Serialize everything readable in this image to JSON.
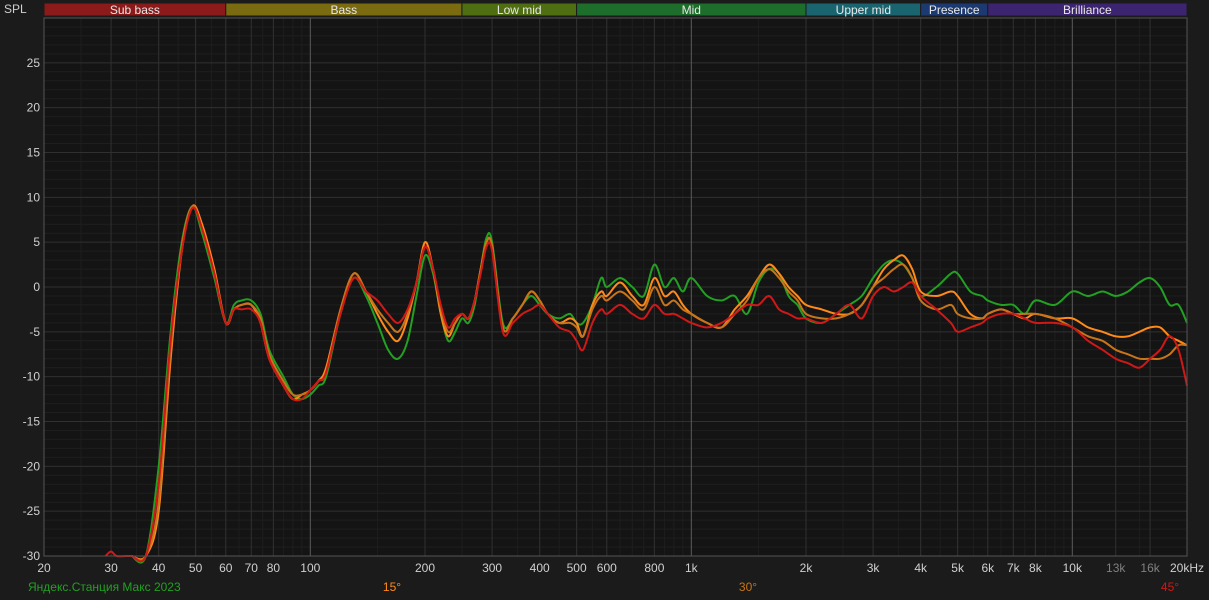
{
  "chart_data": {
    "type": "line",
    "ylabel": "SPL",
    "x_scale": "log",
    "xlim": [
      20,
      20000
    ],
    "ylim": [
      -30,
      30
    ],
    "grid": true,
    "bands": [
      {
        "name": "Sub bass",
        "from": 20,
        "to": 60,
        "color": "#8b1a1a"
      },
      {
        "name": "Bass",
        "from": 60,
        "to": 250,
        "color": "#7a6a10"
      },
      {
        "name": "Low mid",
        "from": 250,
        "to": 500,
        "color": "#4f6e12"
      },
      {
        "name": "Mid",
        "from": 500,
        "to": 2000,
        "color": "#1d6e2a"
      },
      {
        "name": "Upper mid",
        "from": 2000,
        "to": 4000,
        "color": "#1a6470"
      },
      {
        "name": "Presence",
        "from": 4000,
        "to": 6000,
        "color": "#1d3a70"
      },
      {
        "name": "Brilliance",
        "from": 6000,
        "to": 20000,
        "color": "#3d2470"
      }
    ],
    "y_ticks": [
      25,
      20,
      15,
      10,
      5,
      0,
      -5,
      -10,
      -15,
      -20,
      -25,
      -30
    ],
    "x_ticks": [
      {
        "v": 20,
        "label": "20"
      },
      {
        "v": 30,
        "label": "30"
      },
      {
        "v": 40,
        "label": "40"
      },
      {
        "v": 50,
        "label": "50"
      },
      {
        "v": 60,
        "label": "60"
      },
      {
        "v": 70,
        "label": "70"
      },
      {
        "v": 80,
        "label": "80"
      },
      {
        "v": 100,
        "label": "100"
      },
      {
        "v": 200,
        "label": "200"
      },
      {
        "v": 300,
        "label": "300"
      },
      {
        "v": 400,
        "label": "400"
      },
      {
        "v": 500,
        "label": "500"
      },
      {
        "v": 600,
        "label": "600"
      },
      {
        "v": 800,
        "label": "800"
      },
      {
        "v": 1000,
        "label": "1k"
      },
      {
        "v": 2000,
        "label": "2k"
      },
      {
        "v": 3000,
        "label": "3k"
      },
      {
        "v": 4000,
        "label": "4k"
      },
      {
        "v": 5000,
        "label": "5k"
      },
      {
        "v": 6000,
        "label": "6k"
      },
      {
        "v": 7000,
        "label": "7k"
      },
      {
        "v": 8000,
        "label": "8k"
      },
      {
        "v": 10000,
        "label": "10k"
      },
      {
        "v": 13000,
        "label": "13k"
      },
      {
        "v": 16000,
        "label": "16k"
      },
      {
        "v": 20000,
        "label": "20kHz"
      }
    ],
    "series": [
      {
        "name": "Яндекс.Станция Макс 2023",
        "color": "#22a022",
        "x": [
          34,
          37,
          40,
          43,
          46,
          49,
          52,
          56,
          60,
          63,
          66,
          70,
          74,
          78,
          85,
          90,
          95,
          100,
          105,
          110,
          120,
          130,
          140,
          150,
          160,
          170,
          180,
          190,
          200,
          210,
          220,
          230,
          240,
          250,
          260,
          270,
          280,
          290,
          300,
          320,
          340,
          360,
          380,
          400,
          420,
          450,
          480,
          500,
          520,
          550,
          580,
          600,
          650,
          700,
          750,
          800,
          850,
          900,
          950,
          1000,
          1100,
          1200,
          1300,
          1400,
          1500,
          1600,
          1700,
          1800,
          1900,
          2000,
          2200,
          2400,
          2600,
          2800,
          3000,
          3200,
          3400,
          3600,
          3800,
          4000,
          4400,
          4800,
          5000,
          5400,
          5800,
          6000,
          6500,
          7000,
          7500,
          8000,
          9000,
          10000,
          11000,
          12000,
          13000,
          14000,
          15000,
          16000,
          17000,
          18000,
          19000,
          20000
        ],
        "y": [
          -30,
          -30,
          -20,
          -5,
          5,
          9,
          6,
          1,
          -4,
          -2,
          -1.5,
          -1.5,
          -3,
          -7,
          -10,
          -12,
          -12.5,
          -12,
          -11,
          -10,
          -3,
          1,
          -1,
          -4,
          -7,
          -8,
          -6,
          -1,
          3.5,
          1.5,
          -3,
          -6,
          -5,
          -3.5,
          -4,
          -2,
          2,
          5.5,
          5,
          -4,
          -3.5,
          -2,
          -1,
          -2,
          -3,
          -3.5,
          -3,
          -4,
          -4,
          -2,
          1,
          0,
          1,
          0,
          -1,
          2.5,
          0,
          1,
          -0.5,
          1,
          -1,
          -1.5,
          -1,
          -3,
          0.5,
          2,
          1.5,
          -1,
          -2,
          -3.5,
          -4,
          -3,
          -2,
          -1,
          1,
          2.5,
          3,
          2.5,
          1,
          -1,
          0,
          1.5,
          1.5,
          -0.5,
          -1,
          -1.5,
          -2,
          -2,
          -3,
          -1.5,
          -2,
          -0.5,
          -1,
          -0.5,
          -1,
          -0.5,
          0.5,
          1,
          0,
          -2,
          -2,
          -4
        ]
      },
      {
        "name": "15°",
        "color": "#ff8a1a",
        "x": [
          34,
          37,
          40,
          43,
          46,
          49,
          52,
          56,
          60,
          63,
          66,
          70,
          74,
          78,
          85,
          90,
          95,
          100,
          105,
          110,
          120,
          130,
          140,
          150,
          160,
          170,
          180,
          190,
          200,
          210,
          220,
          230,
          240,
          250,
          260,
          270,
          280,
          290,
          300,
          320,
          340,
          360,
          380,
          400,
          420,
          450,
          480,
          500,
          520,
          550,
          580,
          600,
          650,
          700,
          750,
          800,
          850,
          900,
          950,
          1000,
          1100,
          1200,
          1300,
          1400,
          1500,
          1600,
          1700,
          1800,
          1900,
          2000,
          2200,
          2400,
          2600,
          2800,
          3000,
          3200,
          3400,
          3600,
          3800,
          4000,
          4400,
          4800,
          5000,
          5400,
          5800,
          6000,
          6500,
          7000,
          7500,
          8000,
          9000,
          10000,
          11000,
          12000,
          13000,
          14000,
          15000,
          16000,
          17000,
          18000,
          19000,
          20000
        ],
        "y": [
          -30,
          -30,
          -25,
          -8,
          4,
          9,
          7,
          2,
          -4,
          -2.5,
          -2,
          -2,
          -4,
          -8,
          -11,
          -12.5,
          -12,
          -11.5,
          -10.5,
          -9,
          -2.5,
          1.5,
          -0.5,
          -3,
          -5,
          -6,
          -3.5,
          0.5,
          5,
          2,
          -3,
          -5.5,
          -4,
          -3,
          -3.5,
          -1.5,
          2,
          5,
          4.5,
          -4.5,
          -3.5,
          -2,
          -0.5,
          -1.5,
          -3,
          -4,
          -3.5,
          -4,
          -5.5,
          -2,
          -0.5,
          -1,
          0.5,
          -1,
          -2,
          1,
          -1,
          -0.5,
          -2,
          -3,
          -4,
          -4.5,
          -2.5,
          -1,
          1,
          2.5,
          1.5,
          0,
          -1,
          -2,
          -2.5,
          -3,
          -3,
          -2,
          0,
          2,
          3,
          3.5,
          2,
          -0.5,
          -1,
          -0.5,
          -1,
          -3,
          -3.5,
          -3,
          -2.5,
          -3,
          -3.5,
          -3,
          -3.5,
          -3.5,
          -4.5,
          -5,
          -5.5,
          -5.5,
          -5,
          -4.5,
          -4.5,
          -5.5,
          -6,
          -6.5
        ]
      },
      {
        "name": "30°",
        "color": "#c8741a",
        "x": [
          34,
          37,
          40,
          43,
          46,
          49,
          52,
          56,
          60,
          63,
          66,
          70,
          74,
          78,
          85,
          90,
          95,
          100,
          105,
          110,
          120,
          130,
          140,
          150,
          160,
          170,
          180,
          190,
          200,
          210,
          220,
          230,
          240,
          250,
          260,
          270,
          280,
          290,
          300,
          320,
          340,
          360,
          380,
          400,
          420,
          450,
          480,
          500,
          520,
          550,
          580,
          600,
          650,
          700,
          750,
          800,
          850,
          900,
          950,
          1000,
          1100,
          1200,
          1300,
          1400,
          1500,
          1600,
          1700,
          1800,
          1900,
          2000,
          2200,
          2400,
          2600,
          2800,
          3000,
          3200,
          3400,
          3600,
          3800,
          4000,
          4400,
          4800,
          5000,
          5400,
          5800,
          6000,
          6500,
          7000,
          7500,
          8000,
          9000,
          10000,
          11000,
          12000,
          13000,
          14000,
          15000,
          16000,
          17000,
          18000,
          19000,
          20000
        ],
        "y": [
          -30,
          -30,
          -24,
          -7,
          4.5,
          9,
          6.5,
          1.5,
          -4,
          -2.5,
          -2,
          -2,
          -3.5,
          -7.5,
          -10.5,
          -12,
          -12,
          -11.5,
          -10.5,
          -9.5,
          -2.5,
          1.5,
          -0.5,
          -2.5,
          -4,
          -5,
          -3,
          0.5,
          4.5,
          2,
          -2.5,
          -5,
          -4,
          -3,
          -3.5,
          -1.5,
          2,
          5,
          4.5,
          -4.5,
          -3.5,
          -2,
          -0.5,
          -1.5,
          -3,
          -4,
          -4,
          -4.5,
          -5.5,
          -2.5,
          -1,
          -1.5,
          -0.5,
          -1.5,
          -2.5,
          0,
          -2,
          -1.5,
          -2.5,
          -3,
          -4,
          -4.5,
          -3,
          -1.5,
          1,
          2,
          1,
          -0.5,
          -1.5,
          -3,
          -3.5,
          -3.5,
          -3,
          -2,
          0,
          1,
          2,
          2.5,
          1,
          -1.5,
          -2.5,
          -2,
          -3,
          -3.5,
          -3.5,
          -3,
          -2.5,
          -3,
          -3,
          -3,
          -3.5,
          -4.5,
          -5.5,
          -6,
          -7,
          -7.5,
          -8,
          -8,
          -8,
          -7.5,
          -6.5,
          -6.5
        ]
      },
      {
        "name": "45°",
        "color": "#d01818",
        "x": [
          29,
          30,
          31,
          33,
          34,
          37,
          40,
          43,
          46,
          49,
          52,
          56,
          60,
          63,
          66,
          70,
          74,
          78,
          85,
          90,
          95,
          100,
          105,
          110,
          120,
          130,
          140,
          150,
          160,
          170,
          180,
          190,
          200,
          210,
          220,
          230,
          240,
          250,
          260,
          270,
          280,
          290,
          300,
          320,
          340,
          360,
          380,
          400,
          420,
          450,
          480,
          500,
          520,
          550,
          580,
          600,
          650,
          700,
          750,
          800,
          850,
          900,
          950,
          1000,
          1100,
          1200,
          1300,
          1400,
          1500,
          1600,
          1700,
          1800,
          1900,
          2000,
          2200,
          2400,
          2600,
          2800,
          3000,
          3200,
          3400,
          3600,
          3800,
          4000,
          4400,
          4800,
          5000,
          5400,
          5800,
          6000,
          6500,
          7000,
          7500,
          8000,
          9000,
          10000,
          11000,
          12000,
          13000,
          14000,
          15000,
          16000,
          17000,
          18000,
          19000,
          20000
        ],
        "y": [
          -30,
          -29.5,
          -30,
          -30,
          -30,
          -30,
          -22,
          -6,
          4,
          8.8,
          6.5,
          1.5,
          -4,
          -2.5,
          -2.5,
          -2.5,
          -4,
          -8,
          -11,
          -12.5,
          -12.5,
          -11.5,
          -10.5,
          -9.5,
          -3,
          1,
          -0.5,
          -1.5,
          -3,
          -4,
          -2.5,
          0.5,
          4.5,
          2,
          -2,
          -4.5,
          -3.5,
          -3,
          -3.5,
          -1.5,
          1.5,
          4.5,
          4,
          -5,
          -4,
          -3,
          -2.5,
          -2,
          -3,
          -4.5,
          -5,
          -6,
          -7,
          -4,
          -2.5,
          -3,
          -2,
          -3,
          -3.5,
          -2,
          -3,
          -3,
          -3.5,
          -4,
          -4.5,
          -4,
          -3,
          -2,
          -2,
          -1,
          -2.5,
          -3,
          -3.5,
          -3.5,
          -4,
          -3,
          -2,
          -3.5,
          -1,
          0,
          -0.5,
          0,
          0.5,
          -1,
          -2.5,
          -4,
          -5,
          -4.5,
          -4,
          -3.5,
          -3,
          -3,
          -3.5,
          -4,
          -4,
          -4.5,
          -6,
          -7,
          -8,
          -8.5,
          -9,
          -8,
          -7,
          -5.5,
          -7,
          -11
        ]
      }
    ],
    "legend": [
      {
        "name": "Яндекс.Станция Макс 2023",
        "color": "#22a022"
      },
      {
        "name": "15°",
        "color": "#ff8a1a"
      },
      {
        "name": "30°",
        "color": "#c8741a"
      },
      {
        "name": "45°",
        "color": "#d01818"
      }
    ]
  }
}
